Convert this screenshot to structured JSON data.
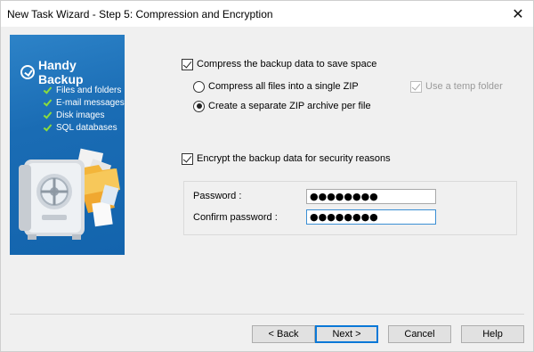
{
  "window": {
    "title": "New Task Wizard - Step 5: Compression and Encryption",
    "close_glyph": "✕"
  },
  "banner": {
    "brand": "Handy Backup",
    "features": [
      "Files and folders",
      "E-mail messages",
      "Disk images",
      "SQL databases"
    ],
    "icons": [
      "check-icon",
      "safe-icon",
      "folder-icon",
      "document-icon"
    ],
    "colors": {
      "background": "#1a6cb4",
      "check": "#8bdc3c"
    }
  },
  "compression": {
    "compress_label": "Compress the backup data to save space",
    "compress_checked": true,
    "single_zip_label": "Compress all files into a single ZIP",
    "single_zip_selected": false,
    "separate_zip_label": "Create a separate ZIP archive per file",
    "separate_zip_selected": true,
    "temp_folder_label": "Use a temp folder",
    "temp_folder_checked": true,
    "temp_folder_enabled": false
  },
  "encryption": {
    "encrypt_label": "Encrypt the backup data for security reasons",
    "encrypt_checked": true,
    "password_label": "Password :",
    "password_value": "●●●●●●●●",
    "confirm_label": "Confirm password :",
    "confirm_value": "●●●●●●●●"
  },
  "buttons": {
    "back": "< Back",
    "next": "Next >",
    "cancel": "Cancel",
    "help": "Help"
  }
}
